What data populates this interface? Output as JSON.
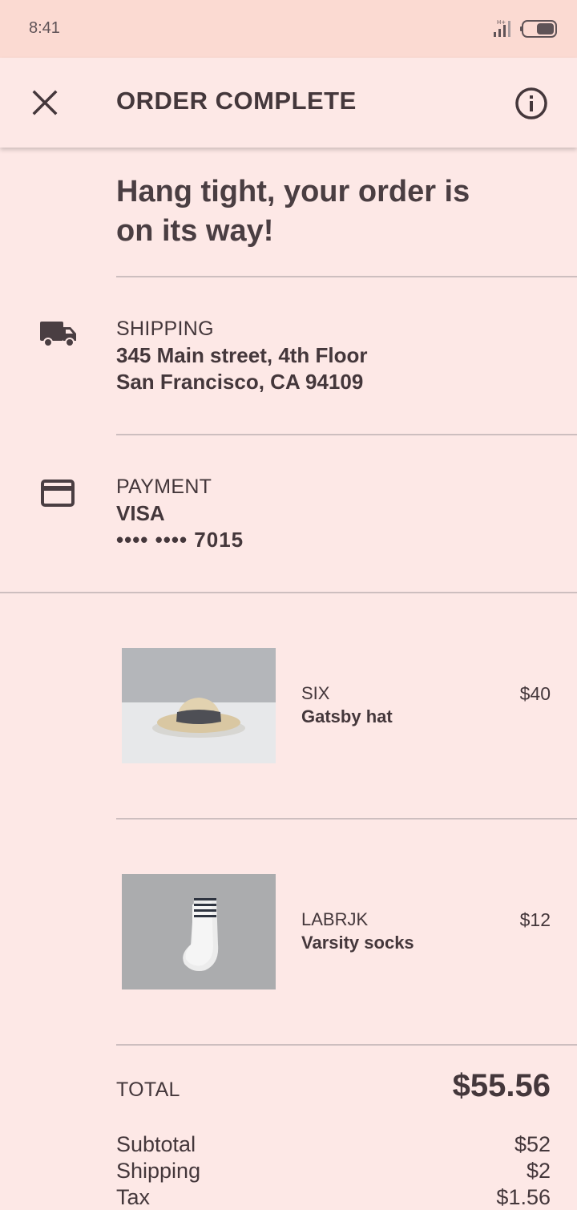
{
  "status_bar": {
    "time": "8:41"
  },
  "app_bar": {
    "title": "ORDER COMPLETE",
    "close_icon": "close-icon",
    "info_icon": "info-icon"
  },
  "headline": "Hang tight, your order is on its way!",
  "shipping": {
    "icon": "truck-icon",
    "label": "SHIPPING",
    "address_line1": "345 Main street, 4th Floor",
    "address_line2": "San Francisco, CA 94109"
  },
  "payment": {
    "icon": "credit-card-icon",
    "label": "PAYMENT",
    "card_type": "VISA",
    "card_masked": "•••• •••• 7015"
  },
  "items": [
    {
      "brand": "SIX",
      "name": "Gatsby hat",
      "price": "$40",
      "image": "hat-image"
    },
    {
      "brand": "LABRJK",
      "name": "Varsity socks",
      "price": "$12",
      "image": "socks-image"
    }
  ],
  "totals": {
    "total_label": "TOTAL",
    "total_value": "$55.56",
    "rows": [
      {
        "label": "Subtotal",
        "value": "$52"
      },
      {
        "label": "Shipping",
        "value": "$2"
      },
      {
        "label": "Tax",
        "value": "$1.56"
      }
    ]
  },
  "colors": {
    "background": "#FDE8E6",
    "status_bar": "#FBDAD2",
    "text": "#44373B",
    "divider": "#CDBEBF"
  }
}
